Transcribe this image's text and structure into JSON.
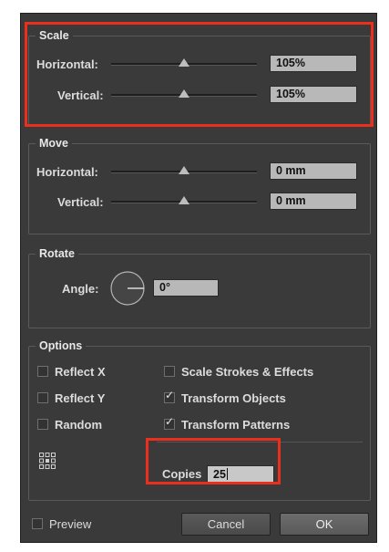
{
  "scale": {
    "legend": "Scale",
    "horizontal_label": "Horizontal:",
    "horizontal_value": "105%",
    "horizontal_slider_level": 0.5,
    "vertical_label": "Vertical:",
    "vertical_value": "105%",
    "vertical_slider_level": 0.5
  },
  "move": {
    "legend": "Move",
    "horizontal_label": "Horizontal:",
    "horizontal_value": "0 mm",
    "horizontal_slider_level": 0.5,
    "vertical_label": "Vertical:",
    "vertical_value": "0 mm",
    "vertical_slider_level": 0.5
  },
  "rotate": {
    "legend": "Rotate",
    "angle_label": "Angle:",
    "angle_value": "0°"
  },
  "options": {
    "legend": "Options",
    "reflect_x": {
      "label": "Reflect X",
      "checked": false
    },
    "reflect_y": {
      "label": "Reflect Y",
      "checked": false
    },
    "random": {
      "label": "Random",
      "checked": false
    },
    "scale_strokes": {
      "label": "Scale Strokes & Effects",
      "checked": false
    },
    "transform_objects": {
      "label": "Transform Objects",
      "checked": true
    },
    "transform_patterns": {
      "label": "Transform Patterns",
      "checked": true
    },
    "reference_point_icon": "reference-point-grid-icon",
    "copies_label": "Copies",
    "copies_value": "25"
  },
  "footer": {
    "preview": {
      "label": "Preview",
      "checked": false
    },
    "cancel_label": "Cancel",
    "ok_label": "OK"
  },
  "colors": {
    "dialog_bg": "#3a3a3a",
    "field_bg": "#b8b8b8",
    "highlight": "#ea2f1c"
  }
}
